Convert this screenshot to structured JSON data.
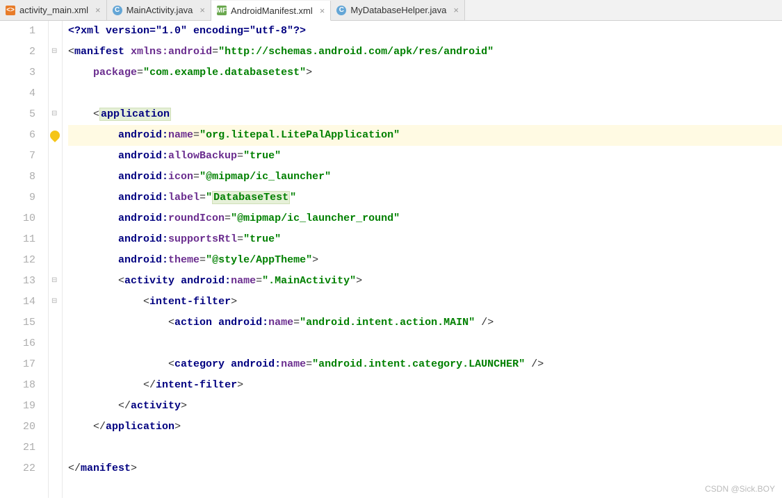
{
  "tabs": [
    {
      "label": "activity_main.xml",
      "icon": "xml",
      "iconText": "<>"
    },
    {
      "label": "MainActivity.java",
      "icon": "java",
      "iconText": "C"
    },
    {
      "label": "AndroidManifest.xml",
      "icon": "mf",
      "iconText": "MF",
      "active": true
    },
    {
      "label": "MyDatabaseHelper.java",
      "icon": "java",
      "iconText": "C"
    }
  ],
  "lineNumbers": [
    "1",
    "2",
    "3",
    "4",
    "5",
    "6",
    "7",
    "8",
    "9",
    "10",
    "11",
    "12",
    "13",
    "14",
    "15",
    "16",
    "17",
    "18",
    "19",
    "20",
    "21",
    "22"
  ],
  "code": {
    "l1_pi": "<?xml version=\"1.0\" encoding=\"utf-8\"?>",
    "l2_tag": "manifest",
    "l2_attr": "xmlns:android",
    "l2_val": "http://schemas.android.com/apk/res/android",
    "l3_attr": "package",
    "l3_val": "com.example.databasetest",
    "l5_tag": "application",
    "l6_attr_ns": "android:",
    "l6_attr_n": "name",
    "l6_val": "org.litepal.LitePalApplication",
    "l7_attr_ns": "android:",
    "l7_attr_n": "allowBackup",
    "l7_val": "true",
    "l8_attr_ns": "android:",
    "l8_attr_n": "icon",
    "l8_val": "@mipmap/ic_launcher",
    "l9_attr_ns": "android:",
    "l9_attr_n": "label",
    "l9_val": "DatabaseTest",
    "l10_attr_ns": "android:",
    "l10_attr_n": "roundIcon",
    "l10_val": "@mipmap/ic_launcher_round",
    "l11_attr_ns": "android:",
    "l11_attr_n": "supportsRtl",
    "l11_val": "true",
    "l12_attr_ns": "android:",
    "l12_attr_n": "theme",
    "l12_val": "@style/AppTheme",
    "l13_tag": "activity",
    "l13_attr_ns": "android:",
    "l13_attr_n": "name",
    "l13_val": ".MainActivity",
    "l14_tag": "intent-filter",
    "l15_tag": "action",
    "l15_attr_ns": "android:",
    "l15_attr_n": "name",
    "l15_val": "android.intent.action.MAIN",
    "l17_tag": "category",
    "l17_attr_ns": "android:",
    "l17_attr_n": "name",
    "l17_val": "android.intent.category.LAUNCHER",
    "l18_ctag": "intent-filter",
    "l19_ctag": "activity",
    "l20_ctag": "application",
    "l22_ctag": "manifest"
  },
  "watermark": "CSDN @Sick.BOY"
}
